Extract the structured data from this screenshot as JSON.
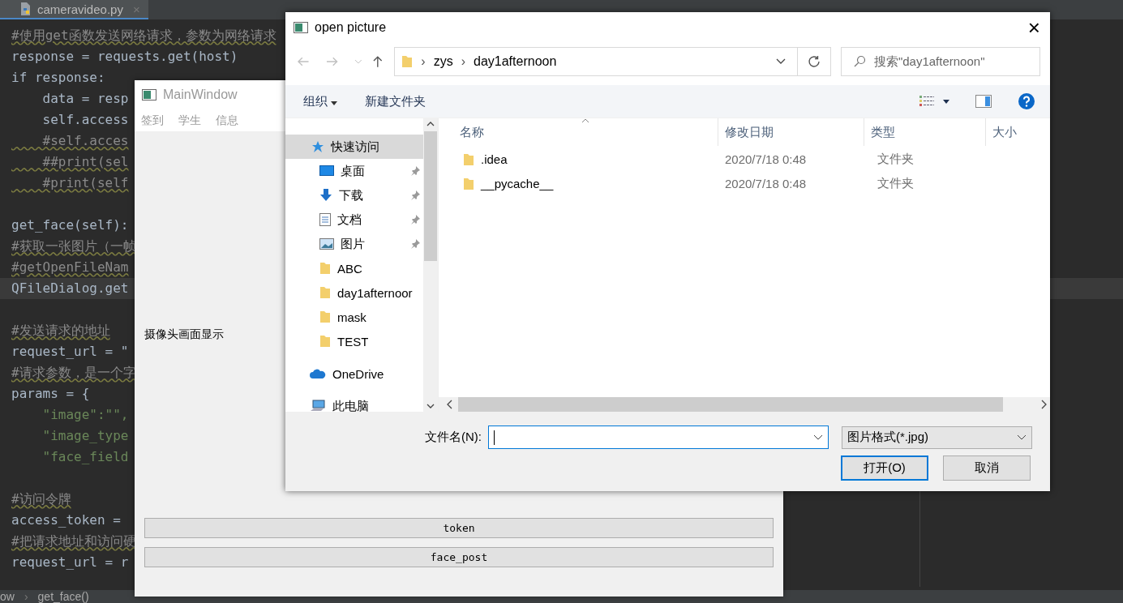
{
  "editor": {
    "tab": {
      "label": "cameravideo.py",
      "close": "×"
    },
    "lines": [
      {
        "kind": "comment",
        "text": "#使用get函数发送网络请求，参数为网络请求",
        "current": false
      },
      {
        "kind": "code",
        "text": "response = requests.get(host)",
        "current": false
      },
      {
        "kind": "code",
        "text": "if response:",
        "current": false
      },
      {
        "kind": "code",
        "text": "    data = resp",
        "current": false
      },
      {
        "kind": "code",
        "text": "    self.access",
        "current": false
      },
      {
        "kind": "comment",
        "text": "    #self.acces",
        "current": false
      },
      {
        "kind": "comment",
        "text": "    ##print(sel",
        "current": false
      },
      {
        "kind": "comment",
        "text": "    #print(self",
        "current": false
      },
      {
        "kind": "blank",
        "current": false
      },
      {
        "kind": "code",
        "text": "get_face(self):",
        "current": false
      },
      {
        "kind": "comment",
        "text": "#获取一张图片（一帧",
        "current": false
      },
      {
        "kind": "comment",
        "text": "#getOpenFileNam",
        "current": false
      },
      {
        "kind": "code",
        "text": "QFileDialog.get",
        "current": true
      },
      {
        "kind": "blank",
        "current": false
      },
      {
        "kind": "comment",
        "text": "#发送请求的地址",
        "current": false
      },
      {
        "kind": "code",
        "text": "request_url = \"",
        "current": false
      },
      {
        "kind": "comment",
        "text": "#请求参数，是一个字",
        "current": false
      },
      {
        "kind": "code",
        "text": "params = {",
        "current": false
      },
      {
        "kind": "string",
        "text": "    \"image\":\"\",",
        "current": false
      },
      {
        "kind": "string",
        "text": "    \"image_type",
        "current": false
      },
      {
        "kind": "string",
        "text": "    \"face_field",
        "current": false
      },
      {
        "kind": "blank",
        "current": false
      },
      {
        "kind": "comment",
        "text": "#访问令牌",
        "current": false
      },
      {
        "kind": "code",
        "text": "access_token = ",
        "current": false
      },
      {
        "kind": "comment",
        "text": "#把请求地址和访问硬",
        "current": false
      },
      {
        "kind": "code",
        "text": "request_url = r",
        "current": false
      }
    ],
    "breadcrumb": [
      "ow",
      "›",
      "get_face()"
    ]
  },
  "main_window": {
    "title": "MainWindow",
    "menu": [
      "签到",
      "学生",
      "信息"
    ],
    "label": "摄像头画面显示",
    "buttons": [
      "token",
      "face_post"
    ]
  },
  "dialog": {
    "title": "open picture",
    "close": "×",
    "address": {
      "path": [
        "zys",
        "day1afternoon"
      ],
      "separator": "›"
    },
    "search": {
      "placeholder": "搜索\"day1afternoon\""
    },
    "toolbar": {
      "organize": "组织",
      "new_folder": "新建文件夹"
    },
    "sidebar": [
      {
        "kind": "star",
        "label": "快速访问",
        "selected": true,
        "pinned": false
      },
      {
        "kind": "desktop",
        "label": "桌面",
        "selected": false,
        "pinned": true
      },
      {
        "kind": "download",
        "label": "下载",
        "selected": false,
        "pinned": true
      },
      {
        "kind": "document",
        "label": "文档",
        "selected": false,
        "pinned": true
      },
      {
        "kind": "image",
        "label": "图片",
        "selected": false,
        "pinned": true
      },
      {
        "kind": "folder",
        "label": "ABC",
        "selected": false,
        "pinned": false
      },
      {
        "kind": "folder",
        "label": "day1afternoor",
        "selected": false,
        "pinned": false
      },
      {
        "kind": "folder",
        "label": "mask",
        "selected": false,
        "pinned": false
      },
      {
        "kind": "folder",
        "label": "TEST",
        "selected": false,
        "pinned": false
      },
      {
        "kind": "cloud",
        "label": "OneDrive",
        "selected": false,
        "pinned": false
      },
      {
        "kind": "pc",
        "label": "此电脑",
        "selected": false,
        "pinned": false
      }
    ],
    "columns": [
      "名称",
      "修改日期",
      "类型",
      "大小"
    ],
    "files": [
      {
        "name": ".idea",
        "modified": "2020/7/18 0:48",
        "type": "文件夹"
      },
      {
        "name": "__pycache__",
        "modified": "2020/7/18 0:48",
        "type": "文件夹"
      }
    ],
    "filename_label": "文件名(N):",
    "filter": "图片格式(*.jpg)",
    "buttons": [
      {
        "label": "打开(O)",
        "default": true
      },
      {
        "label": "取消",
        "default": false
      }
    ]
  }
}
